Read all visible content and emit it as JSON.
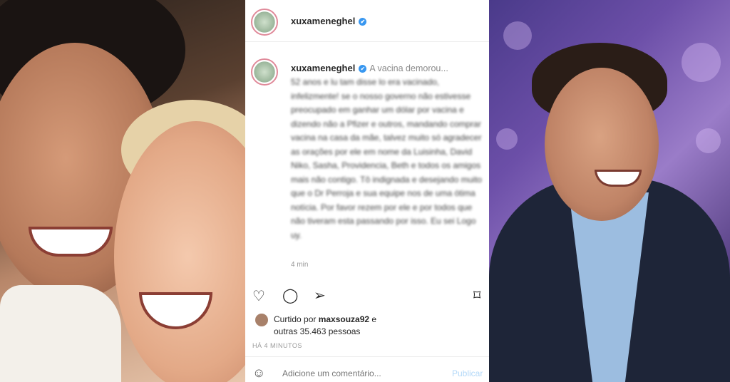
{
  "left_photo": {
    "description_icon": "photo-couple-icon"
  },
  "post": {
    "username": "xuxameneghel",
    "verified_mark": "✔",
    "caption_preview": "A vacina demorou...",
    "caption_blurred": "52 anos e lu tam disse lo era vacinado, infelizmente! se o nosso governo não estivesse preocupado em ganhar um dólar por vacina e dizendo não a Pfizer e outros, mandando comprar vacina na casa da mãe, talvez muito só agradecer as orações por ele em nome da Luisinha, David Niko, Sasha, Providencia, Beth e todos os amigos mais não contigo. Tô indignada e desejando muito que o Dr Perroja e sua equipe nos de uma ótima notícia. Por favor rezem por ele e por todos que não tiveram esta passando por isso. Eu sei Logo uy.",
    "time": "4 min",
    "liked_prefix": "Curtido por ",
    "liked_user": "maxsouza92",
    "liked_and": " e",
    "liked_others": "outras 35.463 pessoas",
    "ago": "HÁ 4 MINUTOS",
    "comment_placeholder": "Adicione um comentário...",
    "post_button": "Publicar"
  },
  "icons": {
    "heart": "♡",
    "comment": "◯",
    "share": "➢",
    "save": "⌑",
    "smiley": "☺"
  },
  "colors": {
    "verified": "#3897f0",
    "post_button": "#b2d8f8"
  }
}
